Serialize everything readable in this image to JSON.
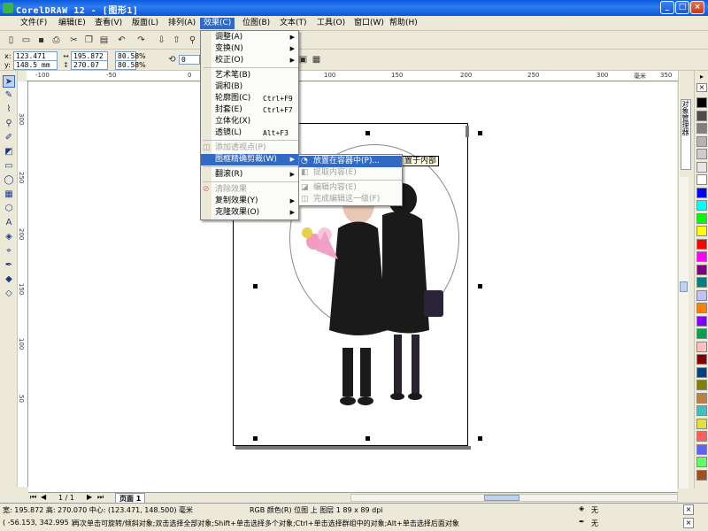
{
  "window": {
    "title": "CorelDRAW 12 - [图形1]"
  },
  "menubar": [
    {
      "label": "文件(F)"
    },
    {
      "label": "编辑(E)"
    },
    {
      "label": "查看(V)"
    },
    {
      "label": "版面(L)"
    },
    {
      "label": "排列(A)"
    },
    {
      "label": "效果(C)"
    },
    {
      "label": "位图(B)"
    },
    {
      "label": "文本(T)"
    },
    {
      "label": "工具(O)"
    },
    {
      "label": "窗口(W)"
    },
    {
      "label": "帮助(H)"
    }
  ],
  "property_bar": {
    "x": "123.471 mm",
    "y": "148.5 mm",
    "width": "195.872 mr",
    "height": "270.07 mm",
    "scale_x": "80.58",
    "scale_y": "80.58",
    "percent": "%",
    "rotation": "0"
  },
  "effects_menu": [
    {
      "label": "调整(A)",
      "arrow": "▶"
    },
    {
      "label": "变换(N)",
      "arrow": "▶"
    },
    {
      "label": "校正(O)",
      "arrow": "▶"
    },
    {
      "label": "艺术笔(B)"
    },
    {
      "label": "调和(B)"
    },
    {
      "label": "轮廓图(C)",
      "shortcut": "Ctrl+F9"
    },
    {
      "label": "封套(E)",
      "shortcut": "Ctrl+F7"
    },
    {
      "label": "立体化(X)"
    },
    {
      "label": "透镜(L)",
      "shortcut": "Alt+F3"
    },
    {
      "label": "添加透视点(P)"
    },
    {
      "label": "图框精确剪裁(W)",
      "arrow": "▶"
    },
    {
      "label": "翻滚(R)",
      "arrow": "▶"
    },
    {
      "label": "清除效果"
    },
    {
      "label": "复制效果(Y)",
      "arrow": "▶"
    },
    {
      "label": "克隆效果(O)",
      "arrow": "▶"
    }
  ],
  "powerclip_submenu": [
    {
      "label": "放置在容器中(P)..."
    },
    {
      "label": "提取内容(E)"
    },
    {
      "label": "编辑内容(E)"
    },
    {
      "label": "完成编辑这一级(F)"
    }
  ],
  "tooltip": "置于内部",
  "rulers": {
    "h": [
      "-100",
      "-50",
      "0",
      "50",
      "100",
      "150",
      "200",
      "250",
      "300",
      "350"
    ],
    "v": [
      "300",
      "250",
      "200",
      "150",
      "100",
      "50"
    ],
    "unit": "毫米"
  },
  "page_bar": {
    "counter": "1 / 1",
    "tab": "页面 1"
  },
  "status": {
    "line1": "宽: 195.872  高: 270.070  中心: (123.471, 148.500)  毫米",
    "object_info": "RGB 颜色(R) 位图 上 图层 1 89 x 89 dpi",
    "line2_coords": "( -56.153, 342.995 )",
    "line2_hint": "再次单击可旋转/倾斜对象;双击选择全部对象;Shift+单击选择多个对象;Ctrl+单击选择群组中的对象;Alt+单击选择后面对象",
    "fill": "无",
    "outline": "无"
  },
  "docker_tab": "对象管理器",
  "colors": {
    "accent": "#316ac5",
    "palette": [
      "#000000",
      "#4d4d4d",
      "#808080",
      "#b3b3b3",
      "#cccccc",
      "#e6e6e6",
      "#ffffff",
      "#0000ff",
      "#00ffff",
      "#00ff00",
      "#ffff00",
      "#ff0000",
      "#ff00ff",
      "#7f007f",
      "#007f7f",
      "#c0c0ff",
      "#ff8000",
      "#8000ff",
      "#00a050",
      "#ffc0c0",
      "#800000",
      "#004080",
      "#808000",
      "#c08040",
      "#40c0c0",
      "#e0e040",
      "#ff6060",
      "#6060ff",
      "#60ff60",
      "#a05020"
    ]
  }
}
